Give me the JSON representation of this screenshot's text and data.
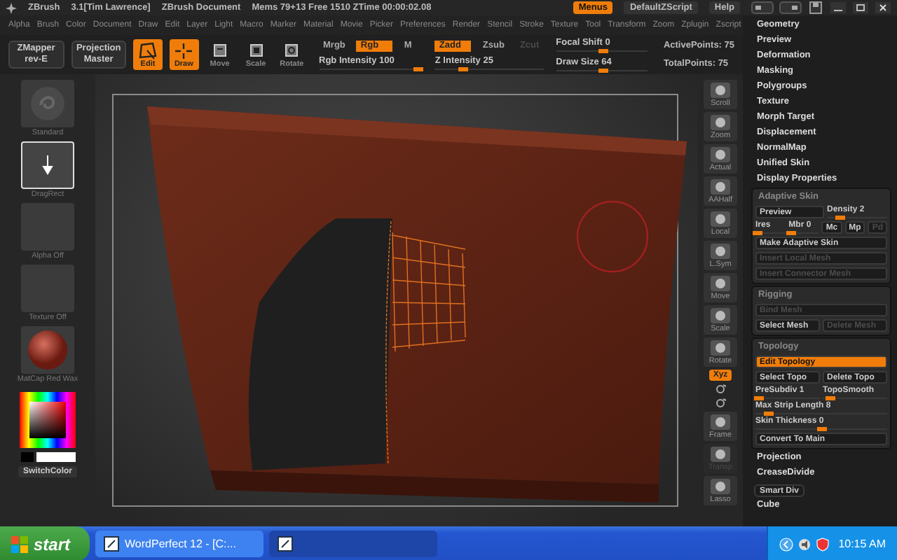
{
  "title_bar": {
    "app": "ZBrush",
    "version": "3.1[Tim Lawrence]",
    "document": "ZBrush Document",
    "stats": "Mems 79+13 Free 1510 ZTime 00:00:02.08",
    "buttons": [
      {
        "label": "Menus",
        "selected": true
      },
      {
        "label": "DefaultZScript",
        "selected": false
      },
      {
        "label": "Help",
        "selected": false
      }
    ]
  },
  "menu": [
    "Alpha",
    "Brush",
    "Color",
    "Document",
    "Draw",
    "Edit",
    "Layer",
    "Light",
    "Macro",
    "Marker",
    "Material",
    "Movie",
    "Picker",
    "Preferences",
    "Render",
    "Stencil",
    "Stroke",
    "Texture",
    "Tool",
    "Transform",
    "Zoom",
    "Zplugin",
    "Zscript"
  ],
  "toolbar": {
    "plugins": [
      {
        "label": "ZMapper",
        "sub": "rev-E"
      },
      {
        "label": "Projection",
        "sub": "Master"
      }
    ],
    "modes": [
      {
        "label": "Edit",
        "selected": true
      },
      {
        "label": "Draw",
        "selected": true
      },
      {
        "label": "Move",
        "selected": false
      },
      {
        "label": "Scale",
        "selected": false
      },
      {
        "label": "Rotate",
        "selected": false
      }
    ],
    "brush_groups": [
      {
        "toggles": [
          {
            "label": "Mrgb",
            "on": false,
            "disabled": false
          },
          {
            "label": "Rgb",
            "on": true,
            "disabled": false
          },
          {
            "label": "M",
            "on": false,
            "disabled": false
          }
        ],
        "slider": {
          "label": "Rgb Intensity 100",
          "level": 0.95
        }
      },
      {
        "toggles": [
          {
            "label": "Zadd",
            "on": true,
            "disabled": false
          },
          {
            "label": "Zsub",
            "on": false,
            "disabled": false
          },
          {
            "label": "Zcut",
            "on": false,
            "disabled": true
          }
        ],
        "slider": {
          "label": "Z Intensity 25",
          "level": 0.25
        }
      }
    ],
    "sliders": [
      {
        "label": "Focal Shift 0",
        "level": 0.5
      },
      {
        "label": "Draw Size 64",
        "level": 0.5
      }
    ],
    "stats": [
      "ActivePoints: 75",
      "TotalPoints: 75"
    ]
  },
  "left_panel": {
    "thumbnails": [
      {
        "label": "Standard",
        "kind": "brush"
      },
      {
        "label": "DragRect",
        "kind": "stroke"
      },
      {
        "label": "Alpha Off",
        "kind": "empty"
      },
      {
        "label": "Texture Off",
        "kind": "empty"
      },
      {
        "label": "MatCap Red Wax",
        "kind": "material"
      }
    ],
    "switch_color": "SwitchColor"
  },
  "right_tools": [
    {
      "kind": "tool",
      "label": "Scroll",
      "disabled": false
    },
    {
      "kind": "tool",
      "label": "Zoom",
      "disabled": false
    },
    {
      "kind": "tool",
      "label": "Actual",
      "disabled": false
    },
    {
      "kind": "tool",
      "label": "AAHalf",
      "disabled": false
    },
    {
      "kind": "tool",
      "label": "Local",
      "disabled": false
    },
    {
      "kind": "tool",
      "label": "L.Sym",
      "disabled": false
    },
    {
      "kind": "tool",
      "label": "Move",
      "disabled": false
    },
    {
      "kind": "tool",
      "label": "Scale",
      "disabled": false
    },
    {
      "kind": "tool",
      "label": "Rotate",
      "disabled": false
    },
    {
      "kind": "toggle",
      "label": "Xyz",
      "selected": true
    },
    {
      "kind": "mini"
    },
    {
      "kind": "mini"
    },
    {
      "kind": "tool",
      "label": "Frame",
      "disabled": false
    },
    {
      "kind": "tool",
      "label": "Transp",
      "disabled": true
    },
    {
      "kind": "tool",
      "label": "Lasso",
      "disabled": false
    }
  ],
  "right_panel": {
    "items": [
      {
        "kind": "heading",
        "label": "Geometry"
      },
      {
        "kind": "heading",
        "label": "Preview"
      },
      {
        "kind": "heading",
        "label": "Deformation"
      },
      {
        "kind": "heading",
        "label": "Masking"
      },
      {
        "kind": "heading",
        "label": "Polygroups"
      },
      {
        "kind": "heading",
        "label": "Texture"
      },
      {
        "kind": "heading",
        "label": "Morph Target"
      },
      {
        "kind": "heading",
        "label": "Displacement"
      },
      {
        "kind": "heading",
        "label": "NormalMap"
      },
      {
        "kind": "heading",
        "label": "Unified Skin"
      },
      {
        "kind": "heading",
        "label": "Display Properties"
      },
      {
        "kind": "group",
        "title": "Adaptive Skin",
        "rows": [
          {
            "controls": [
              {
                "kind": "button",
                "label": "Preview",
                "selected": false,
                "disabled": false
              },
              {
                "kind": "slider",
                "label": "Density 2",
                "level": 0.2
              }
            ]
          },
          {
            "controls": [
              {
                "kind": "slider",
                "label": "Ires",
                "level": 0.05
              },
              {
                "kind": "slider",
                "label": "Mbr 0",
                "level": 0.05
              },
              {
                "kind": "button",
                "label": "Mc",
                "selected": false,
                "disabled": false
              },
              {
                "kind": "button",
                "label": "Mp",
                "selected": false,
                "disabled": false
              },
              {
                "kind": "button",
                "label": "Pd",
                "selected": false,
                "disabled": true
              }
            ]
          },
          {
            "controls": [
              {
                "kind": "button",
                "label": "Make Adaptive Skin",
                "selected": false,
                "disabled": false
              }
            ]
          },
          {
            "controls": [
              {
                "kind": "button",
                "label": "Insert Local Mesh",
                "selected": false,
                "disabled": true
              }
            ]
          },
          {
            "controls": [
              {
                "kind": "button",
                "label": "Insert Connector Mesh",
                "selected": false,
                "disabled": true
              }
            ]
          }
        ]
      },
      {
        "kind": "group",
        "title": "Rigging",
        "rows": [
          {
            "controls": [
              {
                "kind": "button",
                "label": "Bind Mesh",
                "selected": false,
                "disabled": true
              }
            ]
          },
          {
            "controls": [
              {
                "kind": "button",
                "label": "Select Mesh",
                "selected": false,
                "disabled": false
              },
              {
                "kind": "button",
                "label": "Delete Mesh",
                "selected": false,
                "disabled": true
              }
            ]
          }
        ]
      },
      {
        "kind": "group",
        "title": "Topology",
        "rows": [
          {
            "controls": [
              {
                "kind": "button",
                "label": "Edit Topology",
                "selected": true,
                "disabled": false
              }
            ]
          },
          {
            "controls": [
              {
                "kind": "button",
                "label": "Select Topo",
                "selected": false,
                "disabled": false
              },
              {
                "kind": "button",
                "label": "Delete Topo",
                "selected": false,
                "disabled": false
              }
            ]
          },
          {
            "controls": [
              {
                "kind": "slider",
                "label": "PreSubdiv 1",
                "level": 0.05
              },
              {
                "kind": "slider",
                "label": "TopoSmooth",
                "level": 0.1
              }
            ]
          },
          {
            "controls": [
              {
                "kind": "slider",
                "label": "Max Strip Length 8",
                "level": 0.1
              }
            ]
          },
          {
            "controls": [
              {
                "kind": "slider",
                "label": "Skin Thickness 0",
                "level": 0.5
              }
            ]
          },
          {
            "controls": [
              {
                "kind": "button",
                "label": "Convert To Main",
                "selected": false,
                "disabled": false
              }
            ]
          }
        ]
      },
      {
        "kind": "heading",
        "label": "Projection"
      },
      {
        "kind": "heading",
        "label": "CreaseDivide"
      },
      {
        "kind": "button",
        "label": "Smart Div"
      },
      {
        "kind": "heading",
        "label": "Cube"
      }
    ]
  },
  "taskbar": {
    "start": "start",
    "tasks": [
      {
        "label": "WordPerfect 12 - [C:...",
        "selected": false
      },
      {
        "selected": true
      }
    ],
    "clock": "10:15 AM"
  }
}
